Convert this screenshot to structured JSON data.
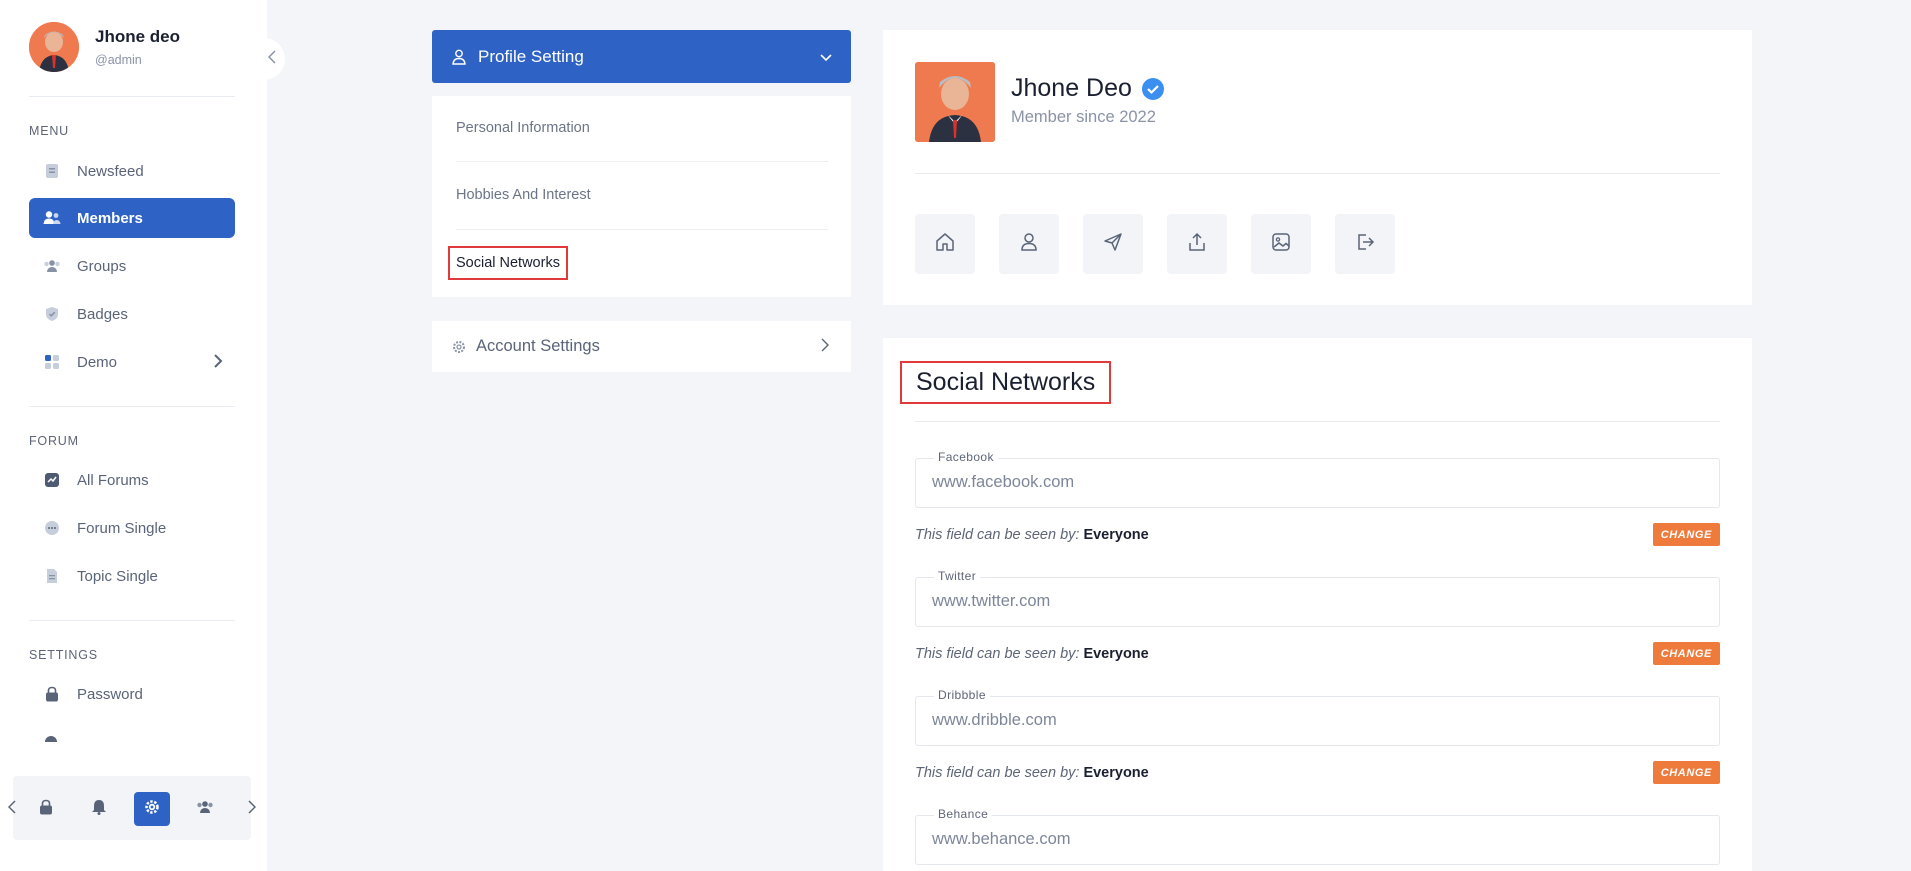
{
  "user": {
    "name": "Jhone deo",
    "handle": "@admin"
  },
  "sidebar": {
    "menu_label": "MENU",
    "menu_items": [
      {
        "label": "Newsfeed",
        "icon": "newsfeed-icon"
      },
      {
        "label": "Members",
        "icon": "members-icon",
        "active": true
      },
      {
        "label": "Groups",
        "icon": "groups-icon"
      },
      {
        "label": "Badges",
        "icon": "badge-icon"
      },
      {
        "label": "Demo",
        "icon": "demo-icon"
      }
    ],
    "forum_label": "FORUM",
    "forum_items": [
      {
        "label": "All Forums",
        "icon": "forums-icon"
      },
      {
        "label": "Forum Single",
        "icon": "forum-single-icon"
      },
      {
        "label": "Topic Single",
        "icon": "topic-icon"
      }
    ],
    "settings_label": "SETTINGS",
    "settings_items": [
      {
        "label": "Password",
        "icon": "lock-icon"
      }
    ],
    "bottom_icons": [
      "lock-icon",
      "bell-icon",
      "settings-icon",
      "users-icon"
    ]
  },
  "settings_menu": {
    "profile_setting": "Profile Setting",
    "items": [
      "Personal Information",
      "Hobbies And Interest",
      "Social Networks"
    ],
    "selected": "Social Networks",
    "account_settings": "Account Settings"
  },
  "profile": {
    "name": "Jhone Deo",
    "member_since": "Member since 2022",
    "actions": [
      "home-icon",
      "user-icon",
      "send-icon",
      "upload-icon",
      "image-icon",
      "logout-icon"
    ]
  },
  "social": {
    "title": "Social Networks",
    "note_prefix": "This field can be seen by:",
    "change_label": "CHANGE",
    "fields": [
      {
        "label": "Facebook",
        "value": "www.facebook.com",
        "visibility": "Everyone"
      },
      {
        "label": "Twitter",
        "value": "www.twitter.com",
        "visibility": "Everyone"
      },
      {
        "label": "Dribbble",
        "value": "www.dribble.com",
        "visibility": "Everyone"
      },
      {
        "label": "Behance",
        "value": "www.behance.com",
        "visibility": ""
      }
    ]
  },
  "colors": {
    "primary": "#2e63c5",
    "accent": "#ee7b3c",
    "highlight": "#e23a3a"
  }
}
